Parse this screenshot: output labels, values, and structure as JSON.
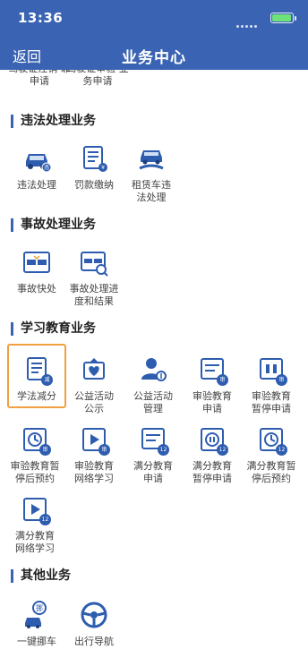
{
  "status_bar": {
    "time": "13:36",
    "battery_level": 0.9
  },
  "header": {
    "back_label": "返回",
    "title": "业务中心"
  },
  "partial_row": {
    "items": [
      "驾驶证注销\n靠申请",
      "驾驶证审验\n业务申请"
    ]
  },
  "sections": [
    {
      "title": "违法处理业务",
      "items": [
        {
          "label": "违法处理",
          "icon": "car-icon"
        },
        {
          "label": "罚款缴纳",
          "icon": "receipt-icon"
        },
        {
          "label": "租赁车违\n法处理",
          "icon": "rental-car-icon"
        }
      ]
    },
    {
      "title": "事故处理业务",
      "items": [
        {
          "label": "事故快处",
          "icon": "accident-icon"
        },
        {
          "label": "事故处理进\n度和结果",
          "icon": "accident-progress-icon"
        }
      ]
    },
    {
      "title": "学习教育业务",
      "items": [
        {
          "label": "学法减分",
          "icon": "study-icon"
        },
        {
          "label": "公益活动\n公示",
          "icon": "heart-icon"
        },
        {
          "label": "公益活动\n管理",
          "icon": "user-manage-icon"
        },
        {
          "label": "审验教育\n申请",
          "icon": "education-apply-icon"
        },
        {
          "label": "审验教育\n暂停申请",
          "icon": "education-pause-icon"
        },
        {
          "label": "审验教育暂\n停后预约",
          "icon": "clock-icon"
        },
        {
          "label": "审验教育\n网络学习",
          "icon": "video-icon"
        },
        {
          "label": "满分教育\n申请",
          "icon": "full-score-apply-icon"
        },
        {
          "label": "满分教育\n暂停申请",
          "icon": "full-score-pause-icon"
        },
        {
          "label": "满分教育暂\n停后预约",
          "icon": "full-score-clock-icon"
        },
        {
          "label": "满分教育\n网络学习",
          "icon": "full-score-video-icon"
        }
      ]
    },
    {
      "title": "其他业务",
      "items": [
        {
          "label": "一键挪车",
          "icon": "move-car-icon"
        },
        {
          "label": "出行导航",
          "icon": "steering-wheel-icon"
        }
      ]
    }
  ],
  "badges": {
    "study": "减",
    "education": "审",
    "full_score": "12"
  },
  "colors": {
    "header": "#3a63b3",
    "icon_blue": "#2e5db0",
    "highlight": "#f0a040"
  }
}
